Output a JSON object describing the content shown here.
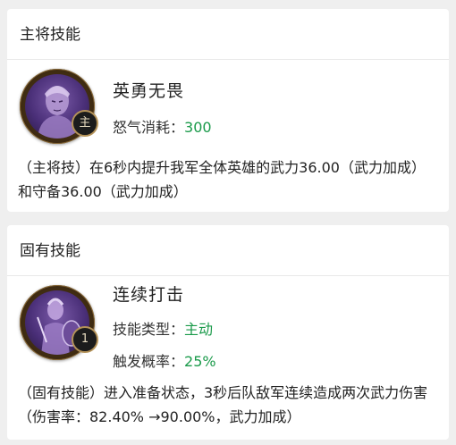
{
  "sections": [
    {
      "header": "主将技能",
      "skill": {
        "name": "英勇无畏",
        "badge": "主",
        "attrs": [
          {
            "label": "怒气消耗：",
            "value": "300"
          }
        ],
        "description": "（主将技）在6秒内提升我军全体英雄的武力36.00（武力加成）和守备36.00（武力加成）"
      }
    },
    {
      "header": "固有技能",
      "skill": {
        "name": "连续打击",
        "badge": "1",
        "attrs": [
          {
            "label": "技能类型：",
            "value": "主动"
          },
          {
            "label": "触发概率：",
            "value": "25%"
          }
        ],
        "description": "（固有技能）进入准备状态，3秒后队敌军连续造成两次武力伤害（伤害率：82.40% →90.00%，武力加成）"
      }
    }
  ],
  "colors": {
    "value_green": "#1a9a4a",
    "background": "#efefef",
    "card": "#ffffff"
  }
}
